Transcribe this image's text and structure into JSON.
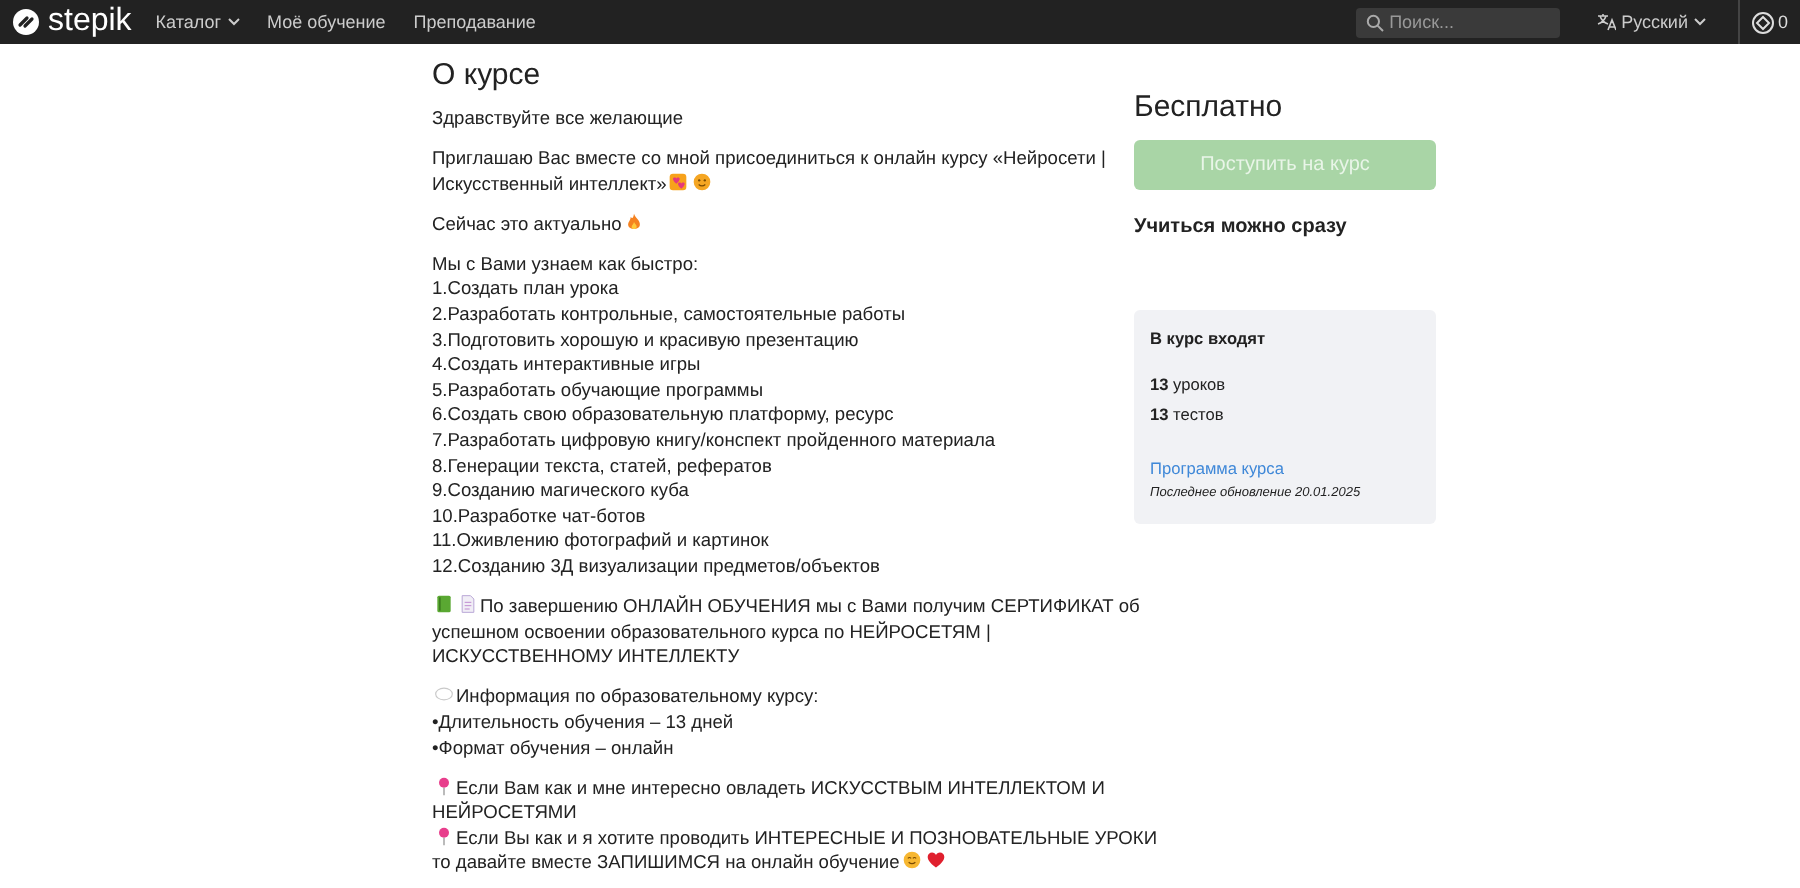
{
  "navbar": {
    "logo": "stepik",
    "menu": [
      {
        "label": "Каталог",
        "dropdown": true
      },
      {
        "label": "Моё обучение",
        "dropdown": false
      },
      {
        "label": "Преподавание",
        "dropdown": false
      }
    ],
    "search": {
      "placeholder": "Поиск..."
    },
    "language": "Русский",
    "points": "0"
  },
  "about": {
    "title": "О курсе",
    "paragraphs": [
      {
        "lines": [
          {
            "text": "Здравствуйте все желающие",
            "kind": "plain"
          }
        ]
      },
      {
        "lines": [
          {
            "text": "Приглашаю Вас вместе со мной присоединиться к онлайн курсу «Нейросети |",
            "kind": "plain"
          },
          {
            "text": "Искусственный интеллект»",
            "kind": "trail-hearts"
          }
        ]
      },
      {
        "lines": [
          {
            "text": "Сейчас это актуально",
            "kind": "trail-fire"
          }
        ]
      },
      {
        "lines": [
          {
            "text": "Мы с Вами узнаем как быстро:",
            "kind": "plain"
          },
          {
            "text": "1.Создать план урока",
            "kind": "plain"
          },
          {
            "text": "2.Разработать контрольные, самостоятельные работы",
            "kind": "plain"
          },
          {
            "text": "3.Подготовить хорошую и красивую презентацию",
            "kind": "plain"
          },
          {
            "text": "4.Создать интерактивные игры",
            "kind": "plain"
          },
          {
            "text": "5.Разработать обучающие программы",
            "kind": "plain"
          },
          {
            "text": "6.Создать свою образовательную платформу, ресурс",
            "kind": "plain"
          },
          {
            "text": "7.Разработать цифровую книгу/конспект пройденного материала",
            "kind": "plain"
          },
          {
            "text": "8.Генерации текста, статей, рефератов",
            "kind": "plain"
          },
          {
            "text": "9.Созданию магического куба",
            "kind": "plain"
          },
          {
            "text": "10.Разработке чат-ботов",
            "kind": "plain"
          },
          {
            "text": "11.Оживлению фотографий и картинок",
            "kind": "plain"
          },
          {
            "text": "12.Созданию 3Д визуализации предметов/объектов",
            "kind": "plain"
          }
        ]
      },
      {
        "lines": [
          {
            "text": "По завершению ОНЛАЙН ОБУЧЕНИЯ мы с Вами получим СЕРТИФИКАТ об",
            "kind": "lead-book"
          },
          {
            "text": "успешном освоении образовательного курса по НЕЙРОСЕТЯМ |",
            "kind": "plain"
          },
          {
            "text": "ИСКУССТВЕННОМУ ИНТЕЛЛЕКТУ",
            "kind": "plain"
          }
        ]
      },
      {
        "lines": [
          {
            "text": "Информация по образовательному курсу:",
            "kind": "lead-bubble"
          },
          {
            "text": "•Длительность обучения – 13 дней",
            "kind": "plain"
          },
          {
            "text": "•Формат обучения – онлайн",
            "kind": "plain"
          }
        ]
      },
      {
        "lines": [
          {
            "text": "Если Вам как и мне интересно овладеть ИСКУССТВЫМ ИНТЕЛЛЕКТОМ И",
            "kind": "lead-pin"
          },
          {
            "text": "НЕЙРОСЕТЯМИ",
            "kind": "plain"
          },
          {
            "text": "Если Вы как и я хотите проводить ИНТЕРЕСНЫЕ И ПОЗНОВАТЕЛЬНЫЕ УРОКИ",
            "kind": "lead-pin"
          },
          {
            "text": "то давайте вместе ЗАПИШИМСЯ на онлайн обучение",
            "kind": "trail-smile"
          }
        ]
      }
    ]
  },
  "sidebar": {
    "price": "Бесплатно",
    "enroll_button": {
      "label": "Поступить на курс",
      "disabled": true
    },
    "start_note": "Учиться можно сразу",
    "includes": {
      "title": "В курс входят",
      "items": [
        {
          "count": "13",
          "label": "уроков"
        },
        {
          "count": "13",
          "label": "тестов"
        }
      ],
      "program_link": "Программа курса",
      "updated": "Последнее обновление 20.01.2025"
    }
  }
}
